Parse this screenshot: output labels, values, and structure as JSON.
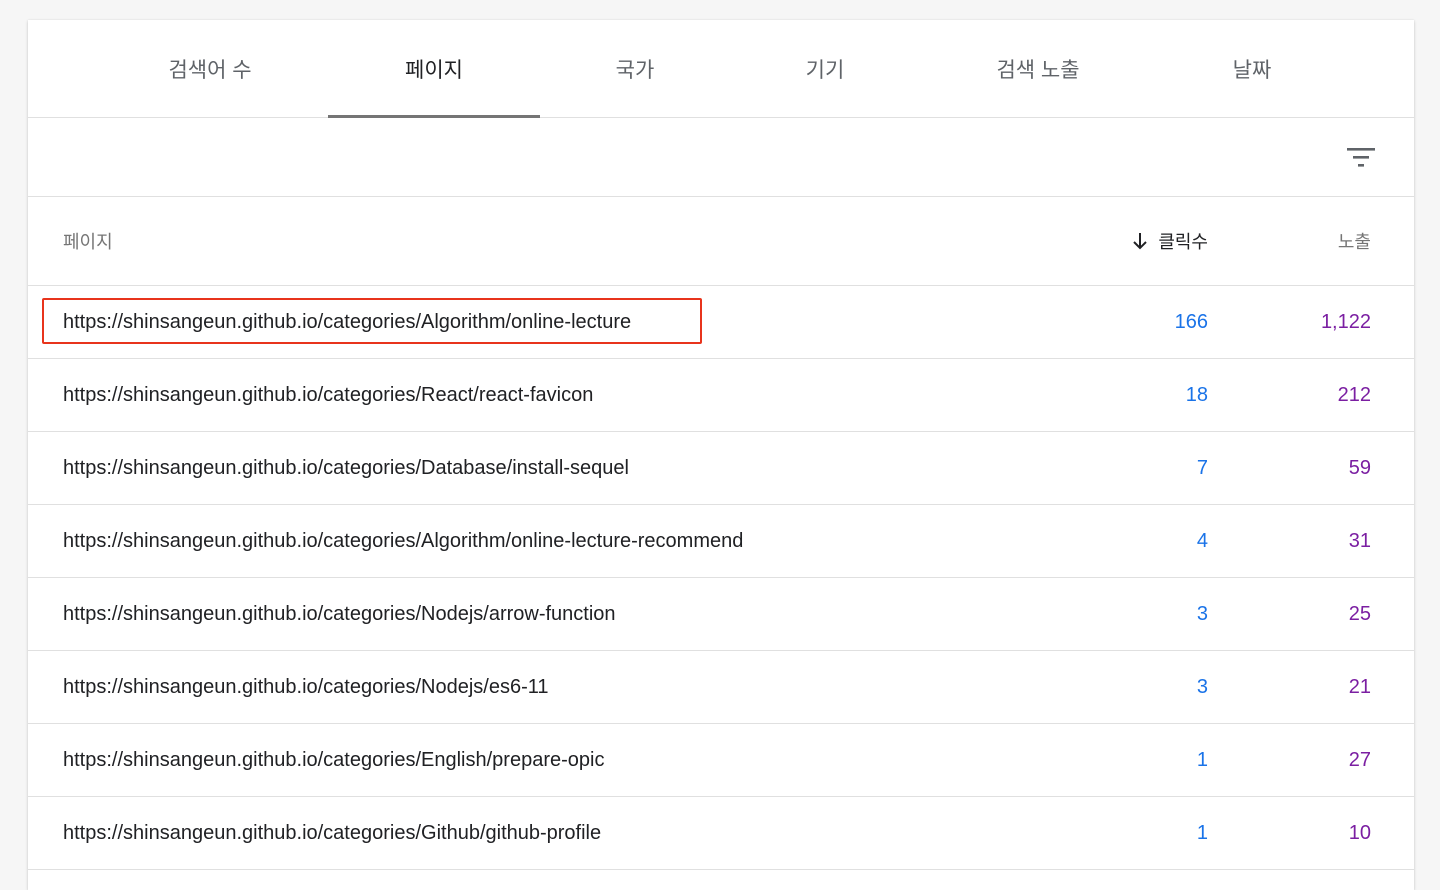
{
  "tabs": [
    {
      "label": "검색어 수"
    },
    {
      "label": "페이지"
    },
    {
      "label": "국가"
    },
    {
      "label": "기기"
    },
    {
      "label": "검색 노출"
    },
    {
      "label": "날짜"
    }
  ],
  "active_tab": "페이지",
  "table": {
    "headers": {
      "page": "페이지",
      "clicks": "클릭수",
      "impressions": "노출"
    },
    "sort": "clicks-descending",
    "rows": [
      {
        "url": "https://shinsangeun.github.io/categories/Algorithm/online-lecture",
        "clicks": "166",
        "impressions": "1,122"
      },
      {
        "url": "https://shinsangeun.github.io/categories/React/react-favicon",
        "clicks": "18",
        "impressions": "212"
      },
      {
        "url": "https://shinsangeun.github.io/categories/Database/install-sequel",
        "clicks": "7",
        "impressions": "59"
      },
      {
        "url": "https://shinsangeun.github.io/categories/Algorithm/online-lecture-recommend",
        "clicks": "4",
        "impressions": "31"
      },
      {
        "url": "https://shinsangeun.github.io/categories/Nodejs/arrow-function",
        "clicks": "3",
        "impressions": "25"
      },
      {
        "url": "https://shinsangeun.github.io/categories/Nodejs/es6-11",
        "clicks": "3",
        "impressions": "21"
      },
      {
        "url": "https://shinsangeun.github.io/categories/English/prepare-opic",
        "clicks": "1",
        "impressions": "27"
      },
      {
        "url": "https://shinsangeun.github.io/categories/Github/github-profile",
        "clicks": "1",
        "impressions": "10"
      }
    ]
  },
  "icons": {
    "filter": "filter-list-icon",
    "sort": "arrow-down-icon"
  },
  "colors": {
    "clicks": "#1a73e8",
    "impressions": "#7b1fa2",
    "highlight": "#e8341c",
    "active_tab_indicator": "#757575"
  }
}
